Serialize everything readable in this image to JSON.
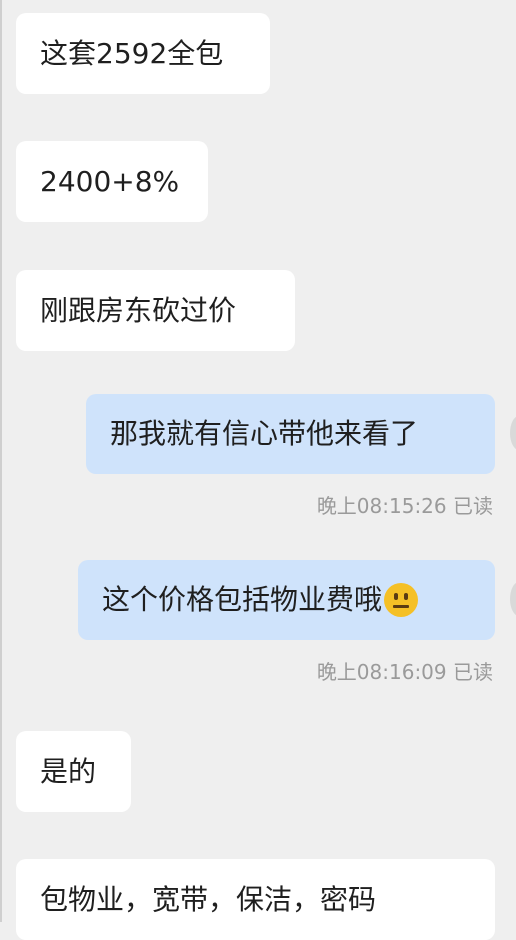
{
  "messages": [
    {
      "direction": "incoming",
      "text": "这套2592全包"
    },
    {
      "direction": "incoming",
      "text": "2400+8%"
    },
    {
      "direction": "incoming",
      "text": "刚跟房东砍过价"
    },
    {
      "direction": "outgoing",
      "text": "那我就有信心带他来看了",
      "time": "晚上08:15:26",
      "read_status": "已读"
    },
    {
      "direction": "outgoing",
      "text": "这个价格包括物业费哦",
      "emoji": "neutral-face-emoji",
      "time": "晚上08:16:09",
      "read_status": "已读"
    },
    {
      "direction": "incoming",
      "text": "是的"
    },
    {
      "direction": "incoming",
      "text": "包物业，宽带，保洁，密码"
    }
  ],
  "colors": {
    "background": "#efefef",
    "incoming_bubble": "#ffffff",
    "outgoing_bubble": "#cfe3fb",
    "text": "#1f1f1f",
    "status_text": "#9a9a9a"
  }
}
